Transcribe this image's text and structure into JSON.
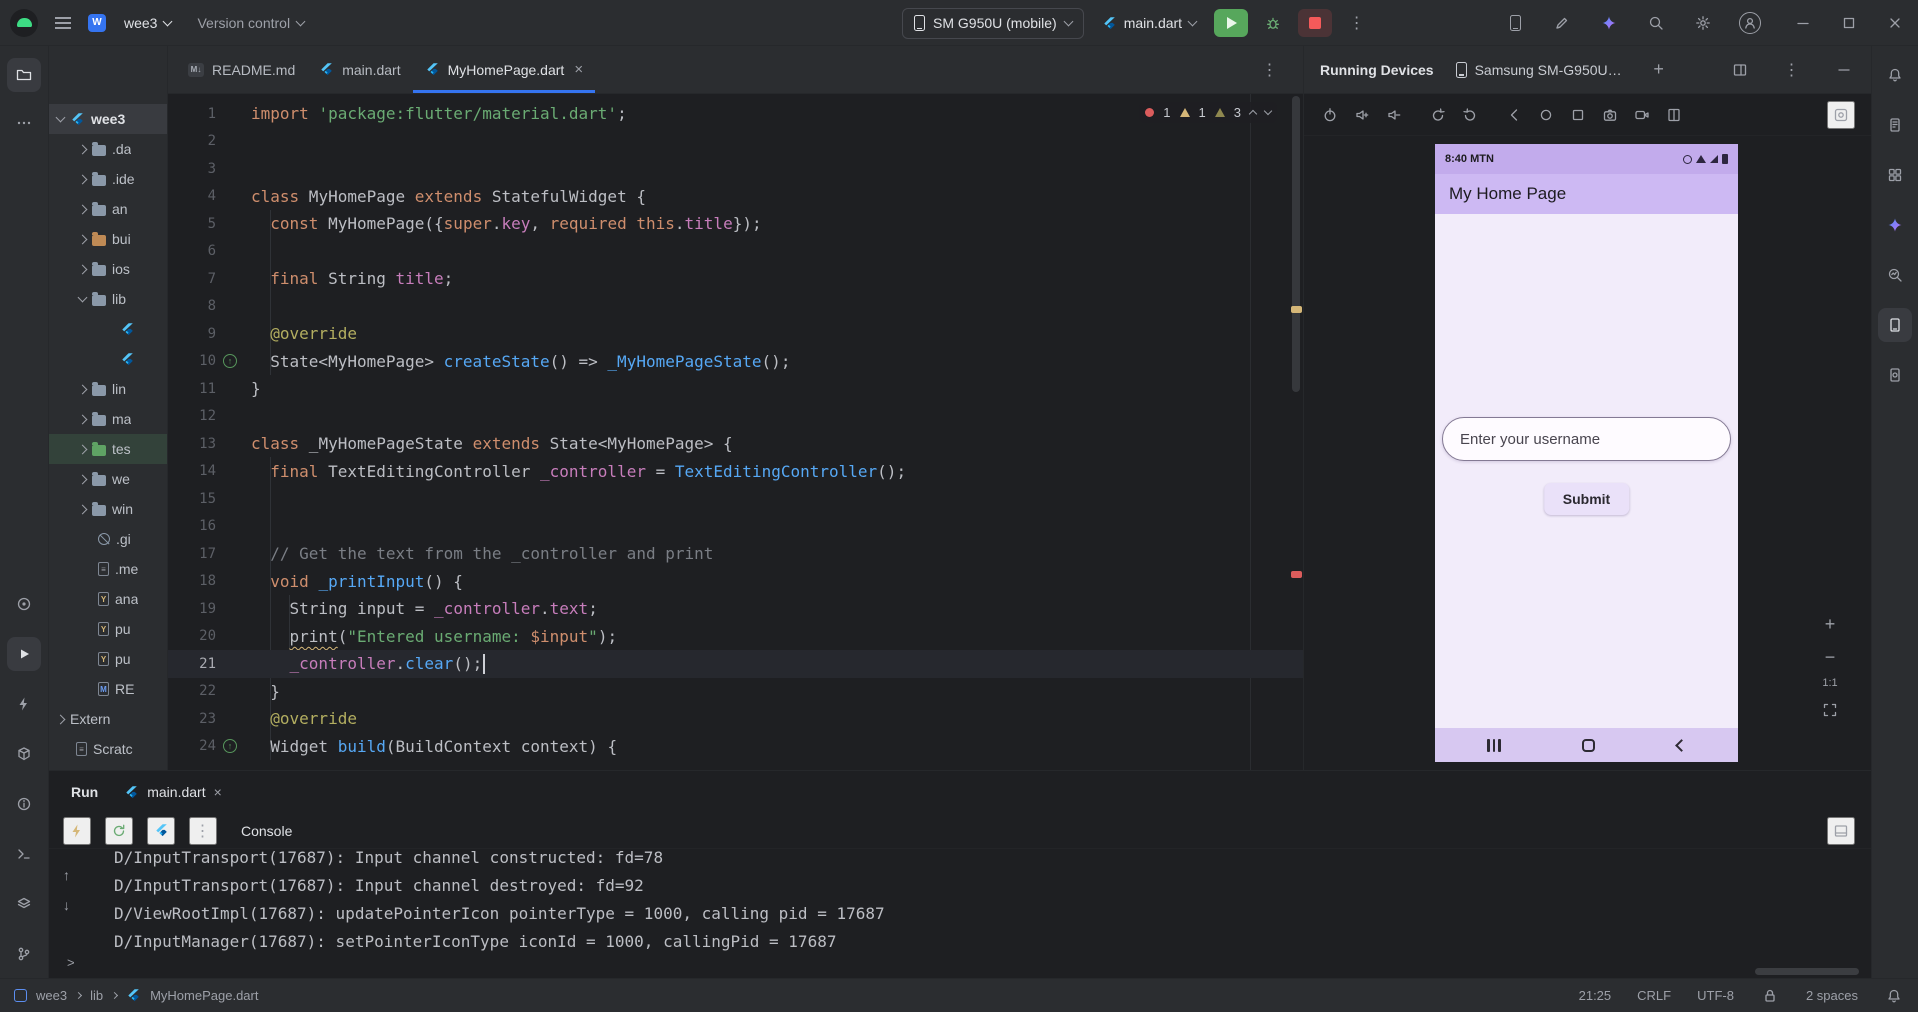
{
  "title_bar": {
    "project": "wee3",
    "project_badge": "W",
    "vcs_label": "Version control",
    "device_selector": "SM G950U (mobile)",
    "run_config": "main.dart"
  },
  "left_strip": {
    "top": [
      {
        "name": "project-folder",
        "active": true
      },
      {
        "name": "more-tools"
      }
    ],
    "bottom": [
      {
        "name": "services"
      },
      {
        "name": "run",
        "active": true
      },
      {
        "name": "profiler"
      },
      {
        "name": "build"
      },
      {
        "name": "problems"
      },
      {
        "name": "terminal"
      },
      {
        "name": "todo"
      },
      {
        "name": "version-control"
      }
    ]
  },
  "right_strip": [
    {
      "name": "notifications"
    },
    {
      "name": "device-explorer"
    },
    {
      "name": "resource-manager"
    },
    {
      "name": "gemini"
    },
    {
      "name": "app-insights"
    },
    {
      "name": "running-devices",
      "active": true
    },
    {
      "name": "device-manager"
    }
  ],
  "project_tree": {
    "items": [
      {
        "label": "wee3",
        "icon": "flutter",
        "chev": "down",
        "depth": 0,
        "sel": true,
        "root": true
      },
      {
        "label": ".da",
        "icon": "folder",
        "chev": "right",
        "depth": 1
      },
      {
        "label": ".ide",
        "icon": "folder",
        "chev": "right",
        "depth": 1
      },
      {
        "label": "an",
        "icon": "folder",
        "chev": "right",
        "depth": 1
      },
      {
        "label": "bui",
        "icon": "folder-orange",
        "chev": "right",
        "depth": 1
      },
      {
        "label": "ios",
        "icon": "folder",
        "chev": "right",
        "depth": 1
      },
      {
        "label": "lib",
        "icon": "folder",
        "chev": "down",
        "depth": 1
      },
      {
        "label": "",
        "icon": "flutter",
        "depth": 2
      },
      {
        "label": "",
        "icon": "flutter",
        "depth": 2
      },
      {
        "label": "lin",
        "icon": "folder",
        "chev": "right",
        "depth": 1
      },
      {
        "label": "ma",
        "icon": "folder",
        "chev": "right",
        "depth": 1
      },
      {
        "label": "tes",
        "icon": "folder-green",
        "chev": "right",
        "depth": 1,
        "hl": "green"
      },
      {
        "label": "we",
        "icon": "folder",
        "chev": "right",
        "depth": 1
      },
      {
        "label": "win",
        "icon": "folder",
        "chev": "right",
        "depth": 1
      },
      {
        "label": ".gi",
        "icon": "git",
        "depth": 1
      },
      {
        "label": ".me",
        "icon": "file-gray",
        "depth": 1
      },
      {
        "label": "ana",
        "icon": "yaml",
        "depth": 1
      },
      {
        "label": "pu",
        "icon": "yaml",
        "depth": 1
      },
      {
        "label": "pu",
        "icon": "yaml",
        "depth": 1
      },
      {
        "label": "RE",
        "icon": "md",
        "depth": 1
      },
      {
        "label": "Extern",
        "icon": "none",
        "chev": "right",
        "depth": 0
      },
      {
        "label": "Scratc",
        "icon": "file-gray",
        "depth": 0
      }
    ]
  },
  "editor": {
    "tabs": [
      {
        "label": "README.md",
        "icon": "md"
      },
      {
        "label": "main.dart",
        "icon": "flutter"
      },
      {
        "label": "MyHomePage.dart",
        "icon": "flutter",
        "active": true,
        "close": "×"
      }
    ],
    "inspections": {
      "errors": "1",
      "warnings": "1",
      "weak_warnings": "3"
    },
    "code": {
      "current_line": 21,
      "lines": [
        {
          "t": [
            [
              "import",
              "kw"
            ],
            [
              " ",
              "d"
            ],
            [
              "'package:flutter/material.dart'",
              "str"
            ],
            [
              ";",
              "d"
            ]
          ]
        },
        {
          "t": []
        },
        {
          "t": []
        },
        {
          "t": [
            [
              "class",
              "kw"
            ],
            [
              " MyHomePage ",
              "d"
            ],
            [
              "extends",
              "kw"
            ],
            [
              " StatefulWidget {",
              "d"
            ]
          ]
        },
        {
          "t": [
            [
              "  ",
              "d"
            ],
            [
              "const",
              "kw"
            ],
            [
              " MyHomePage({",
              "d"
            ],
            [
              "super",
              "kw"
            ],
            [
              ".",
              "d"
            ],
            [
              "key",
              "fld"
            ],
            [
              ", ",
              "d"
            ],
            [
              "required",
              "kw"
            ],
            [
              " ",
              "d"
            ],
            [
              "this",
              "kw"
            ],
            [
              ".",
              "d"
            ],
            [
              "title",
              "fld"
            ],
            [
              "});",
              "d"
            ]
          ]
        },
        {
          "t": []
        },
        {
          "t": [
            [
              "  ",
              "d"
            ],
            [
              "final",
              "kw"
            ],
            [
              " String ",
              "d"
            ],
            [
              "title",
              "fld"
            ],
            [
              ";",
              "d"
            ]
          ]
        },
        {
          "t": []
        },
        {
          "t": [
            [
              "  ",
              "d"
            ],
            [
              "@override",
              "ann"
            ]
          ]
        },
        {
          "t": [
            [
              "  State<MyHomePage> ",
              "d"
            ],
            [
              "createState",
              "fn"
            ],
            [
              "() => ",
              "d"
            ],
            [
              "_MyHomePageState",
              "fn"
            ],
            [
              "();",
              "d"
            ]
          ],
          "m": "override"
        },
        {
          "t": [
            [
              "}",
              "d"
            ]
          ]
        },
        {
          "t": []
        },
        {
          "t": [
            [
              "class",
              "kw"
            ],
            [
              " _MyHomePageState ",
              "d"
            ],
            [
              "extends",
              "kw"
            ],
            [
              " State<MyHomePage> {",
              "d"
            ]
          ]
        },
        {
          "t": [
            [
              "  ",
              "d"
            ],
            [
              "final",
              "kw"
            ],
            [
              " TextEditingController ",
              "d"
            ],
            [
              "_controller",
              "fld"
            ],
            [
              " = ",
              "d"
            ],
            [
              "TextEditingController",
              "fn"
            ],
            [
              "();",
              "d"
            ]
          ]
        },
        {
          "t": []
        },
        {
          "t": []
        },
        {
          "t": [
            [
              "  ",
              "d"
            ],
            [
              "// Get the text from the _controller and print",
              "cmt"
            ]
          ]
        },
        {
          "t": [
            [
              "  ",
              "d"
            ],
            [
              "void",
              "kw"
            ],
            [
              " ",
              "d"
            ],
            [
              "_printInput",
              "fn"
            ],
            [
              "() {",
              "d"
            ]
          ]
        },
        {
          "t": [
            [
              "    String ",
              "d"
            ],
            [
              "input",
              "d"
            ],
            [
              " = ",
              "d"
            ],
            [
              "_controller",
              "fld"
            ],
            [
              ".",
              "d"
            ],
            [
              "text",
              "fld"
            ],
            [
              ";",
              "d"
            ]
          ]
        },
        {
          "t": [
            [
              "    ",
              "d"
            ],
            [
              "print",
              "warn"
            ],
            [
              "(",
              "d"
            ],
            [
              "\"Entered username: ",
              "str"
            ],
            [
              "$input",
              "kw"
            ],
            [
              "\"",
              "str"
            ],
            [
              ");",
              "d"
            ]
          ]
        },
        {
          "t": [
            [
              "    ",
              "d"
            ],
            [
              "_controller",
              "fld"
            ],
            [
              ".",
              "d"
            ],
            [
              "clear",
              "fn"
            ],
            [
              "();",
              "d"
            ]
          ],
          "cursor": true
        },
        {
          "t": [
            [
              "  }",
              "d"
            ]
          ]
        },
        {
          "t": [
            [
              "  ",
              "d"
            ],
            [
              "@override",
              "ann"
            ]
          ]
        },
        {
          "t": [
            [
              "  Widget ",
              "d"
            ],
            [
              "build",
              "fn"
            ],
            [
              "(BuildContext ",
              "d"
            ],
            [
              "context",
              "d"
            ],
            [
              ") {",
              "d"
            ]
          ],
          "m": "override"
        }
      ]
    }
  },
  "device_panel": {
    "title": "Running Devices",
    "device_tab": "Samsung SM-G950U…",
    "toolbar": [
      "power",
      "volume-up",
      "volume-down",
      "rotate-left",
      "rotate-right",
      "back",
      "home",
      "overview",
      "camera",
      "record",
      "fold"
    ],
    "toolbar_right": "snapshot",
    "screen": {
      "status_clock": "8:40 MTN",
      "app_bar_title": "My Home Page",
      "input_placeholder": "Enter your username",
      "submit_label": "Submit"
    },
    "zoom": {
      "in": "+",
      "out": "−",
      "ratio": "1:1"
    }
  },
  "run_panel": {
    "title": "Run",
    "tab": "main.dart",
    "console_tab": "Console",
    "console_lines": [
      "D/InputTransport(17687): Input channel constructed: fd=78",
      "D/InputTransport(17687): Input channel destroyed: fd=92",
      "D/ViewRootImpl(17687): updatePointerIcon pointerType = 1000, calling pid = 17687",
      "D/InputManager(17687): setPointerIconType iconId = 1000, callingPid = 17687"
    ]
  },
  "status_bar": {
    "crumbs": [
      "wee3",
      "lib",
      "MyHomePage.dart"
    ],
    "caret": "21:25",
    "line_separator": "CRLF",
    "encoding": "UTF-8",
    "indent": "2 spaces"
  }
}
